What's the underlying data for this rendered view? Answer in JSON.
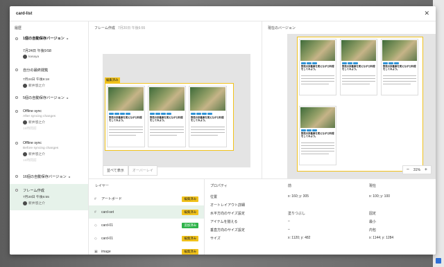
{
  "modal": {
    "title": "card-list",
    "close": "✕"
  },
  "sidebar": {
    "heading": "履歴",
    "versions": [
      {
        "title": "1個の自動保存バージョン",
        "chevron": "▸"
      },
      {
        "title": "7月24日 午後9:58",
        "user": "kasaya"
      },
      {
        "title": "自分の最終閲覧",
        "sub": "7月24日 午後9:18",
        "user": "新井悠之介"
      },
      {
        "title": "5個の自動保存バージョン",
        "chevron": "▸"
      },
      {
        "title": "Offline sync",
        "sub": "After syncing changes",
        "user": "新井悠之介",
        "sub2": "16時間前"
      },
      {
        "title": "Offline sync",
        "sub": "Before syncing changes",
        "user": "新井悠之介",
        "sub2": "16時間前"
      },
      {
        "title": "16個の自動保存バージョン",
        "chevron": "▸"
      },
      {
        "title": "フレーム作成",
        "sub": "7月20日 午後6:55",
        "user": "新井悠之介"
      }
    ]
  },
  "center": {
    "title": "フレーム作成",
    "subtitle": "7月20日 午後6:55",
    "frame_tag": "編集済み",
    "card_title": "野菜の栄養素を覚えながら料理をしてみよう。",
    "tabs": [
      "並べて表示",
      "オーバーレイ"
    ]
  },
  "right": {
    "title": "現在のバージョン",
    "zoom": "31%",
    "zoom_out": "−",
    "zoom_in": "+"
  },
  "layers": {
    "heading": "レイヤー",
    "items": [
      {
        "name": "アートボード",
        "icon": "#",
        "badge": "編集済み",
        "badge_type": "edit"
      },
      {
        "name": "card-set",
        "icon": "#",
        "badge": "編集済み",
        "badge_type": "edit",
        "selected": true
      },
      {
        "name": "card-01",
        "icon": "◇",
        "badge": "追加済み",
        "badge_type": "add"
      },
      {
        "name": "card-01",
        "icon": "◇",
        "badge": "編集済み",
        "badge_type": "edit"
      },
      {
        "name": "image",
        "icon": "▣",
        "badge": "編集済み",
        "badge_type": "edit"
      }
    ]
  },
  "props": {
    "headers": [
      "プロパティ",
      "前",
      "現在"
    ],
    "rows": [
      [
        "位置",
        "x: 160; y: 305",
        "x: 100; y: 100"
      ],
      [
        "オートレイアウト詳細",
        "",
        ""
      ],
      [
        "水平方向のサイズ設定",
        "塗りつぶし",
        "固定"
      ],
      [
        "アイテムを揃える",
        "–",
        "最小"
      ],
      [
        "垂直方向のサイズ設定",
        "–",
        "内包"
      ],
      [
        "サイズ",
        "x: 1120; y: 482",
        "x: 1144; y: 1284"
      ]
    ]
  },
  "colors": {
    "accent_yellow": "#f1c21b",
    "added_green": "#2fb34a",
    "selected_bg": "#e6f2ea",
    "chip_blue": "#2f93d6"
  }
}
